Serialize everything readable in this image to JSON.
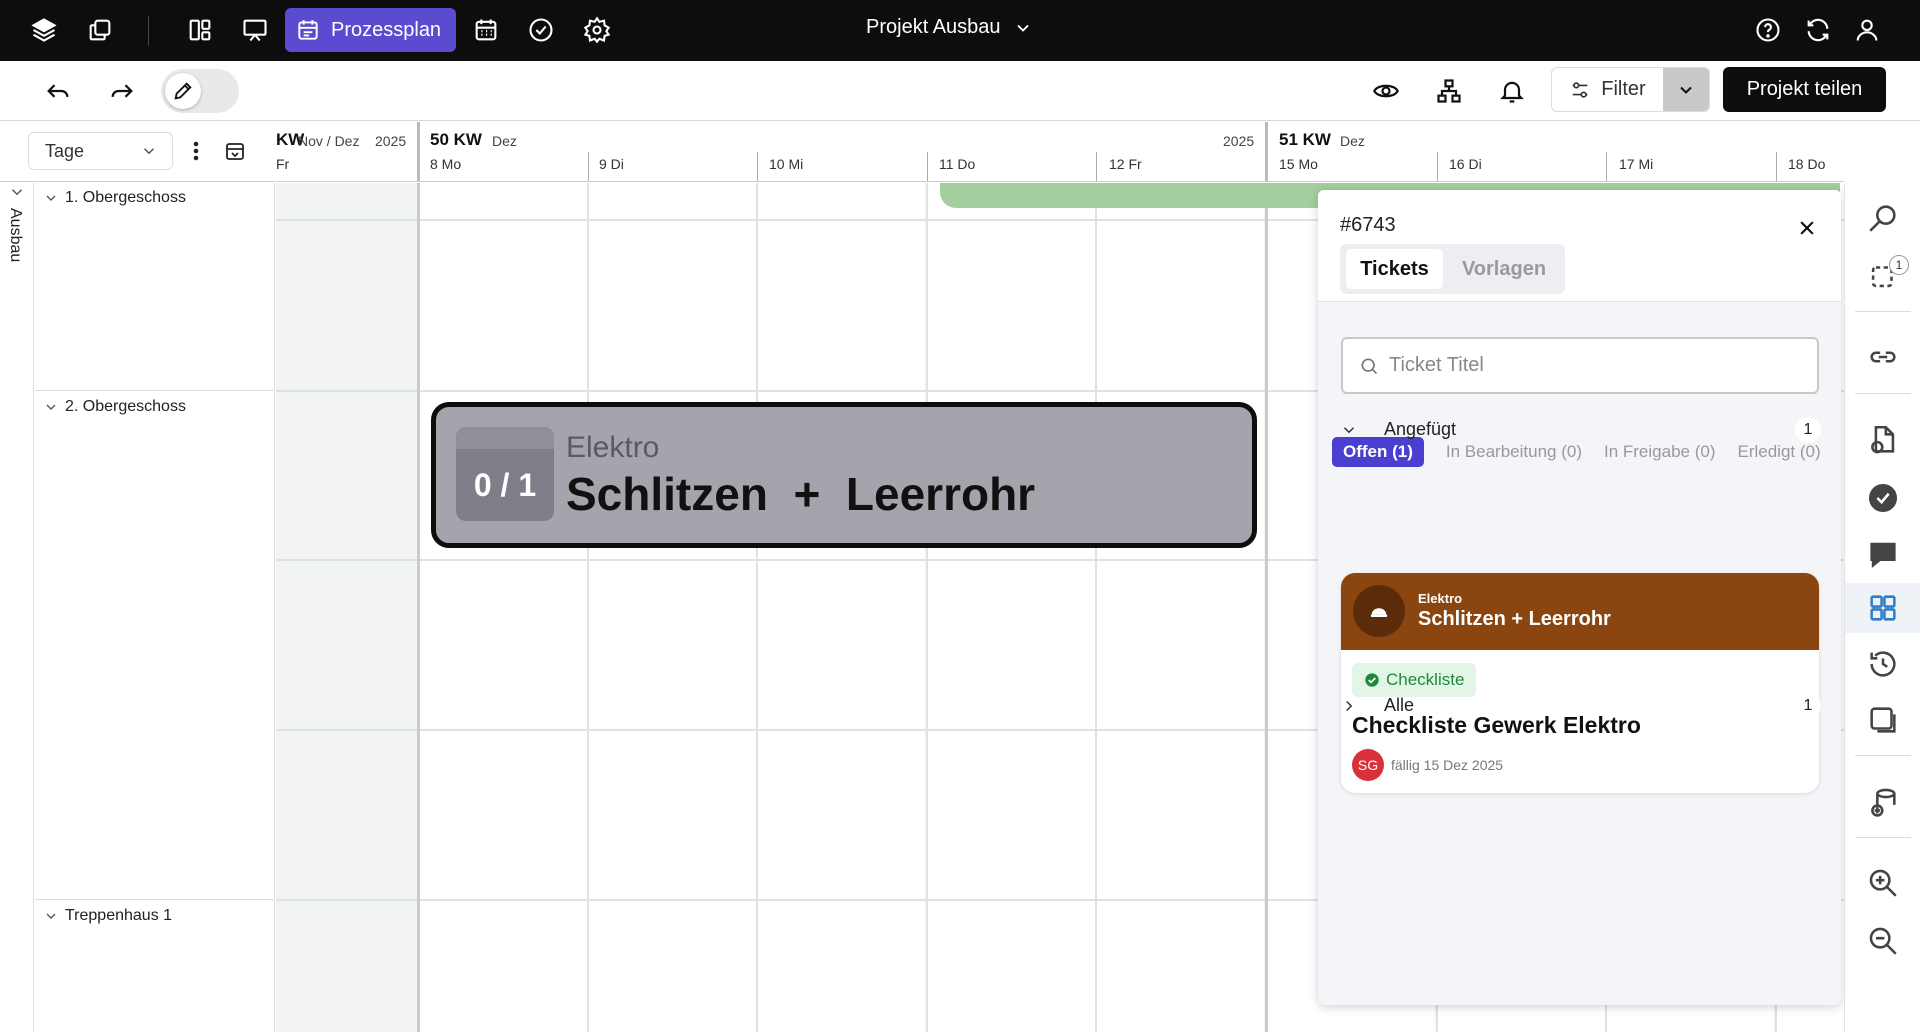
{
  "topbar": {
    "active_view_label": "Prozessplan",
    "project_title": "Projekt Ausbau"
  },
  "toolbar": {
    "filter_label": "Filter",
    "share_label": "Projekt teilen"
  },
  "sidebar": {
    "zoom_select_value": "Tage",
    "vertical_label": "Ausbau",
    "groups": [
      {
        "label": "1. Obergeschoss"
      },
      {
        "label": "2. Obergeschoss"
      },
      {
        "label": "Treppenhaus 1"
      }
    ]
  },
  "timeline": {
    "prev_week": {
      "kw": "KW",
      "months": "Nov / Dez",
      "year": "2025",
      "last_day": "Fr"
    },
    "weeks": [
      {
        "kw": "50 KW",
        "month": "Dez",
        "year": "2025"
      },
      {
        "kw": "51 KW",
        "month": "Dez"
      }
    ],
    "days": [
      "8 Mo",
      "9 Di",
      "10 Mi",
      "11 Do",
      "12 Fr",
      "15 Mo",
      "16 Di",
      "17 Mi",
      "18 Do"
    ]
  },
  "task": {
    "counter": "0 / 1",
    "trade": "Elektro",
    "title": "Schlitzen  +  Leerrohr"
  },
  "panel": {
    "id": "#6743",
    "tabs": [
      "Tickets",
      "Vorlagen"
    ],
    "search_placeholder": "Ticket Titel",
    "status_tabs": [
      "Offen (1)",
      "In Bearbeitung (0)",
      "In Freigabe (0)",
      "Erledigt (0)"
    ],
    "sections": [
      {
        "label": "Angefügt",
        "count": "1"
      },
      {
        "label": "Alle",
        "count": "1"
      }
    ],
    "ticket": {
      "trade": "Elektro",
      "title": "Schlitzen + Leerrohr",
      "badge": "Checkliste",
      "name": "Checkliste Gewerk Elektro",
      "user_initials": "SG",
      "due": "fällig 15 Dez 2025",
      "header_color": "#8b4510"
    }
  },
  "rail": {
    "selection_badge": "1"
  },
  "colors": {
    "accent": "#5b4bd1",
    "status_active": "#4a3fd1",
    "task_bar": "#a4a4ac",
    "green_bar": "#a4cda0"
  }
}
